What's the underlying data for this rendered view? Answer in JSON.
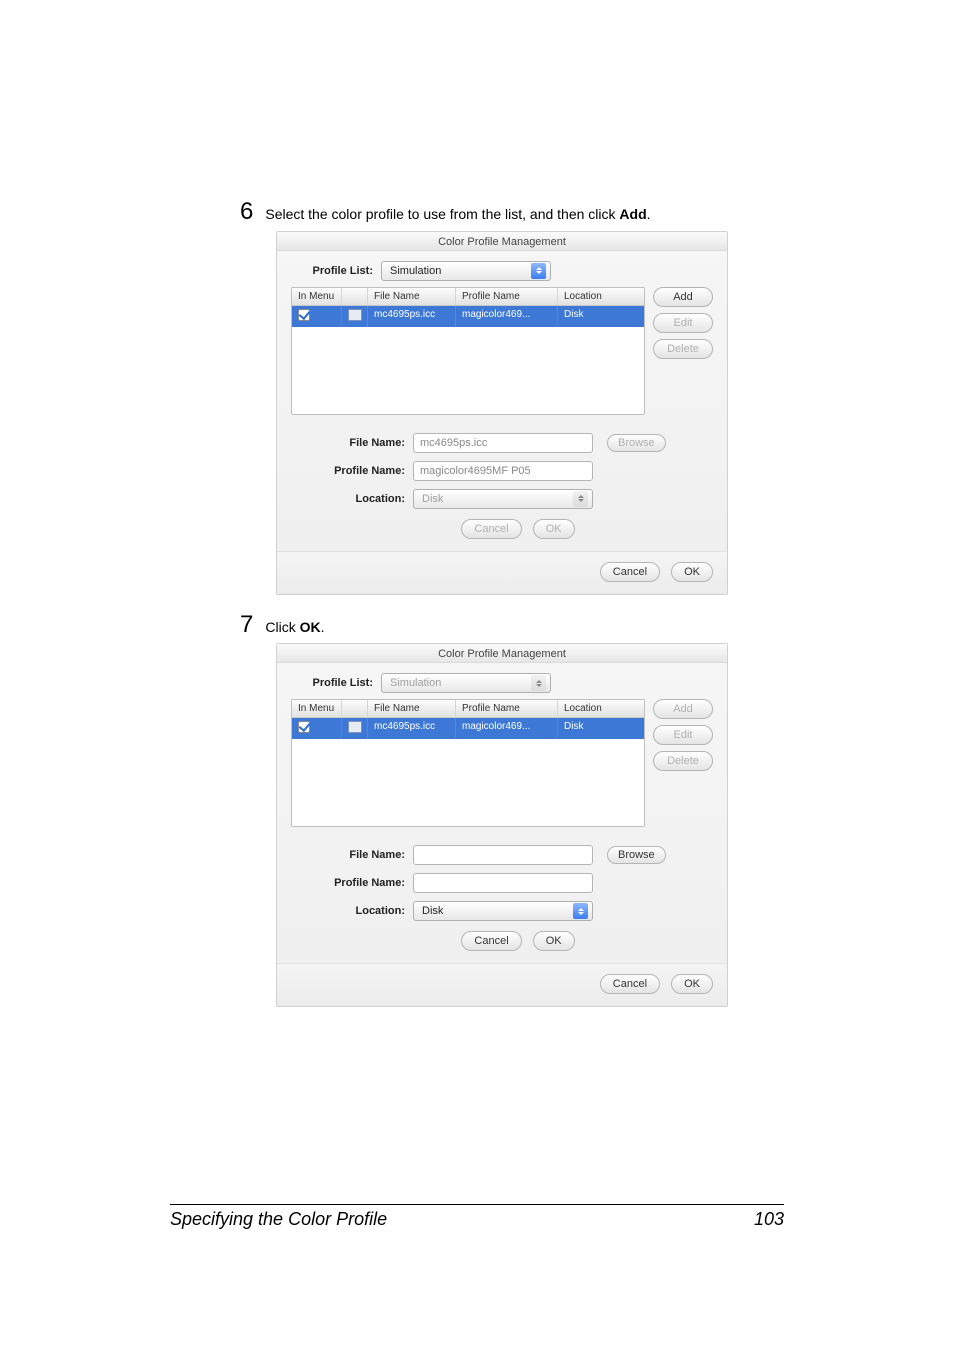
{
  "steps": {
    "s6": {
      "num": "6",
      "text_pre": "Select the color profile to use from the list, and then click ",
      "bold": "Add",
      "text_post": "."
    },
    "s7": {
      "num": "7",
      "text_pre": "Click ",
      "bold": "OK",
      "text_post": "."
    }
  },
  "dialog": {
    "title": "Color Profile Management",
    "profile_list_label": "Profile List:",
    "profile_list_value": "Simulation",
    "columns": {
      "in_menu": "In Menu",
      "file_name": "File Name",
      "profile_name": "Profile Name",
      "location": "Location"
    },
    "row": {
      "file_name": "mc4695ps.icc",
      "profile_name": "magicolor469...",
      "location": "Disk"
    },
    "buttons": {
      "add": "Add",
      "edit": "Edit",
      "delete": "Delete",
      "browse": "Browse",
      "cancel": "Cancel",
      "ok": "OK"
    },
    "form": {
      "file_name_label": "File Name:",
      "profile_name_label": "Profile Name:",
      "location_label": "Location:",
      "location_value": "Disk"
    }
  },
  "dialog1_form_values": {
    "file_name": "mc4695ps.icc",
    "profile_name": "magicolor4695MF P05"
  },
  "dialog2_form_values": {
    "file_name": "",
    "profile_name": ""
  },
  "footer": {
    "title": "Specifying the Color Profile",
    "page": "103"
  }
}
